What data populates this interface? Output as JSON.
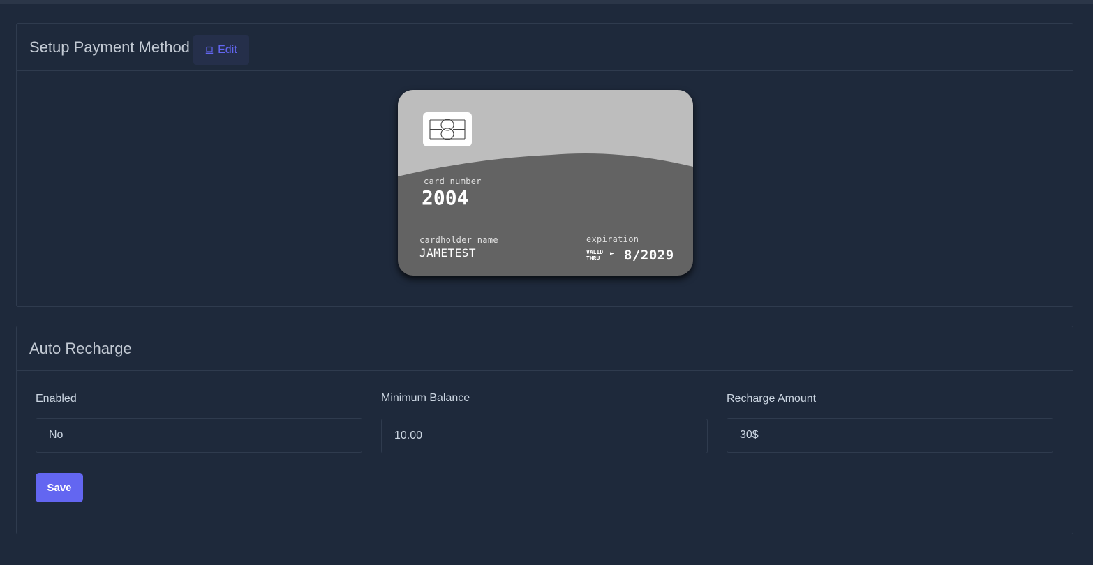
{
  "payment_panel": {
    "title": "Setup Payment Method",
    "edit_label": "Edit",
    "card": {
      "number_label": "card number",
      "number": "2004",
      "holder_label": "cardholder name",
      "holder": "JAMETEST",
      "expiration_label": "expiration",
      "valid_line1": "VALID",
      "valid_line2": "THRU",
      "arrow": "►",
      "expiration": "8/2029"
    }
  },
  "recharge_panel": {
    "title": "Auto Recharge",
    "enabled_label": "Enabled",
    "enabled_value": "No",
    "min_balance_label": "Minimum Balance",
    "min_balance_value": "10.00",
    "recharge_amount_label": "Recharge Amount",
    "recharge_amount_value": "30$",
    "save_label": "Save"
  }
}
